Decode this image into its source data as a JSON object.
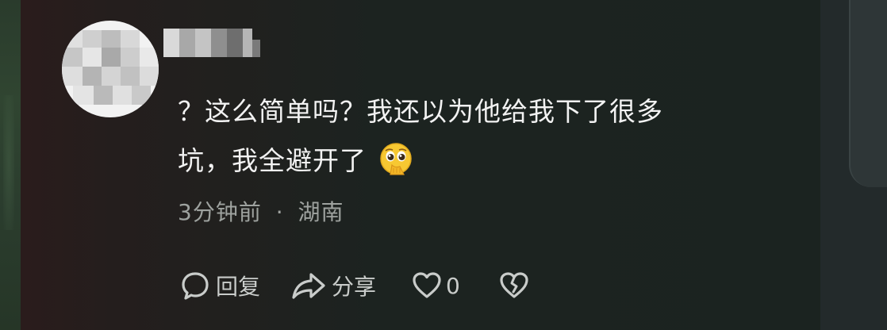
{
  "comment": {
    "line1": "？这么简单吗？我还以为他给我下了很多",
    "line2": "坑，我全避开了",
    "emoji": "pleading-face-hand-over-mouth-emoji"
  },
  "meta": {
    "time": "3分钟前",
    "separator": "·",
    "location": "湖南"
  },
  "actions": {
    "reply_label": "回复",
    "share_label": "分享",
    "like_count": "0"
  },
  "icons": {
    "reply": "comment-bubble-icon",
    "share": "share-arrow-icon",
    "like": "heart-icon",
    "dislike": "broken-heart-icon"
  },
  "colors": {
    "comment_text": "#f2f2f2",
    "meta_text": "#9ea29f",
    "action_text": "#c9ccca",
    "emoji_yellow": "#f7c832"
  }
}
